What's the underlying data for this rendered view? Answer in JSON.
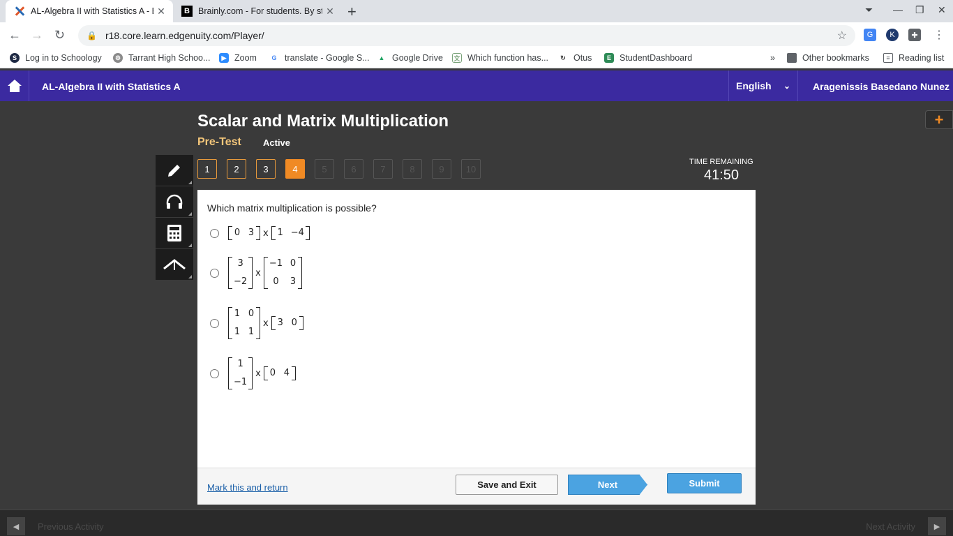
{
  "browser": {
    "tabs": [
      {
        "title": "AL-Algebra II with Statistics A - E",
        "active": true,
        "icon": "edgenuity-x-icon"
      },
      {
        "title": "Brainly.com - For students. By st",
        "active": false,
        "icon": "brainly-b-icon"
      }
    ],
    "url": "r18.core.learn.edgenuity.com/Player/",
    "bookmarks": [
      {
        "label": "Log in to Schoology",
        "icon": "schoology-icon",
        "color": "#1f2a44"
      },
      {
        "label": "Tarrant High Schoo...",
        "icon": "school-icon",
        "color": "#8a8a8a"
      },
      {
        "label": "Zoom",
        "icon": "zoom-icon",
        "color": "#2d8cff"
      },
      {
        "label": "translate - Google S...",
        "icon": "google-icon",
        "color": "#4285f4"
      },
      {
        "label": "Google Drive",
        "icon": "drive-icon",
        "color": "#1fa463"
      },
      {
        "label": "Which function has...",
        "icon": "translate-icon",
        "color": "#7aa37a"
      },
      {
        "label": "Otus",
        "icon": "otus-icon",
        "color": "#333333"
      },
      {
        "label": "StudentDashboard",
        "icon": "dashboard-icon",
        "color": "#2e8b57"
      }
    ],
    "other_bookmarks": "Other bookmarks",
    "reading_list": "Reading list"
  },
  "app": {
    "course_title": "AL-Algebra II with Statistics A",
    "language": "English",
    "user_name": "Aragenissis Basedano Nunez",
    "accent": "#3b2aa0"
  },
  "lesson": {
    "title": "Scalar and Matrix Multiplication",
    "type": "Pre-Test",
    "status": "Active",
    "time_label": "TIME REMAINING",
    "time_value": "41:50",
    "questions": [
      {
        "n": "1",
        "state": "answered"
      },
      {
        "n": "2",
        "state": "answered"
      },
      {
        "n": "3",
        "state": "answered"
      },
      {
        "n": "4",
        "state": "current"
      },
      {
        "n": "5",
        "state": "disabled"
      },
      {
        "n": "6",
        "state": "disabled"
      },
      {
        "n": "7",
        "state": "disabled"
      },
      {
        "n": "8",
        "state": "disabled"
      },
      {
        "n": "9",
        "state": "disabled"
      },
      {
        "n": "10",
        "state": "disabled"
      }
    ]
  },
  "question": {
    "prompt": "Which matrix multiplication is possible?",
    "times_symbol": "x",
    "options": [
      {
        "a": {
          "rows": 1,
          "cols": 2,
          "cells": [
            "0",
            "3"
          ]
        },
        "b": {
          "rows": 1,
          "cols": 2,
          "cells": [
            "1",
            "−4"
          ]
        }
      },
      {
        "a": {
          "rows": 2,
          "cols": 1,
          "cells": [
            "3",
            "−2"
          ]
        },
        "b": {
          "rows": 2,
          "cols": 2,
          "cells": [
            "−1",
            "0",
            "0",
            "3"
          ]
        }
      },
      {
        "a": {
          "rows": 2,
          "cols": 2,
          "cells": [
            "1",
            "0",
            "1",
            "1"
          ]
        },
        "b": {
          "rows": 1,
          "cols": 2,
          "cells": [
            "3",
            "0"
          ]
        }
      },
      {
        "a": {
          "rows": 2,
          "cols": 1,
          "cells": [
            "1",
            "−1"
          ]
        },
        "b": {
          "rows": 1,
          "cols": 2,
          "cells": [
            "0",
            "4"
          ]
        }
      }
    ]
  },
  "footer": {
    "mark_label": "Mark this and return",
    "save_label": "Save and Exit",
    "next_label": "Next",
    "submit_label": "Submit"
  },
  "bottom": {
    "prev_label": "Previous Activity",
    "next_label": "Next Activity"
  }
}
